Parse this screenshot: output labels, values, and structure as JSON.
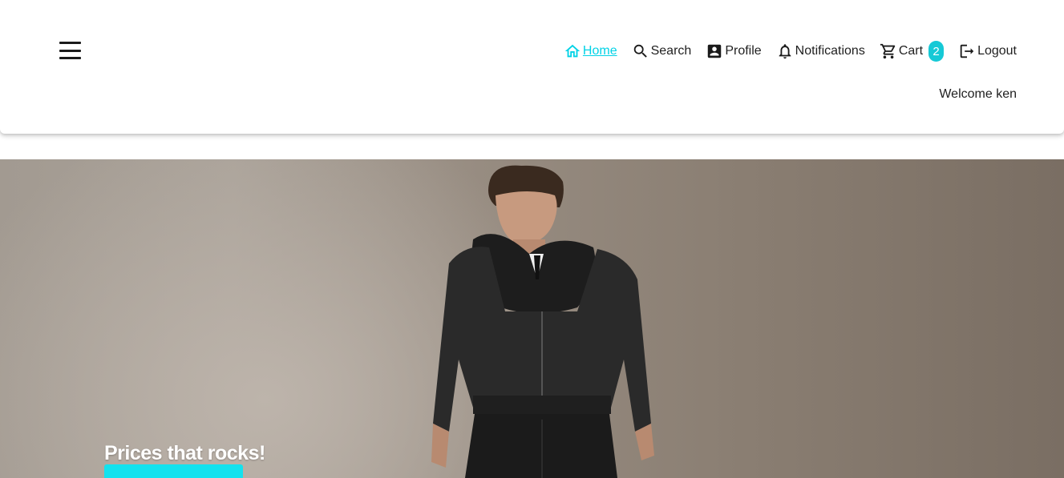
{
  "nav": {
    "items": [
      {
        "label": "Home",
        "icon": "home-icon"
      },
      {
        "label": "Search",
        "icon": "search-icon"
      },
      {
        "label": "Profile",
        "icon": "profile-icon"
      },
      {
        "label": "Notifications",
        "icon": "bell-icon"
      },
      {
        "label": "Cart",
        "icon": "cart-icon",
        "badge": "2"
      },
      {
        "label": "Logout",
        "icon": "logout-icon"
      }
    ],
    "active": "Home"
  },
  "welcome": "Welcome ken",
  "hero": {
    "title": "Prices that rocks!",
    "button_label": ""
  },
  "colors": {
    "accent": "#00d2e6",
    "badge": "#15c9d6",
    "hero_button": "#13e2ee",
    "text": "#1f1f1f"
  }
}
